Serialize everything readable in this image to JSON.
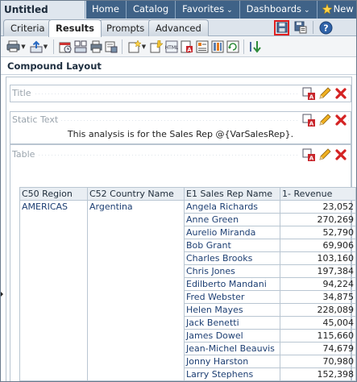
{
  "window": {
    "title": "Untitled"
  },
  "nav": {
    "links": [
      {
        "label": "Home",
        "caret": ""
      },
      {
        "label": "Catalog",
        "caret": ""
      },
      {
        "label": "Favorites",
        "caret": "⌄"
      },
      {
        "label": "Dashboards",
        "caret": "⌄"
      }
    ],
    "new_label": "New",
    "new_caret": "⌄"
  },
  "tabs": [
    {
      "label": "Criteria",
      "active": false
    },
    {
      "label": "Results",
      "active": true
    },
    {
      "label": "Prompts",
      "active": false
    },
    {
      "label": "Advanced",
      "active": false
    }
  ],
  "tab_icons": [
    "save-icon",
    "save-as-icon",
    "help-icon"
  ],
  "toolbar_icons": [
    "print-icon",
    "export-icon",
    "schedule-icon",
    "view-layout-icon",
    "print-preview-icon",
    "new-view-icon",
    "edit-view-icon",
    "html-icon",
    "pdf-icon",
    "properties-icon",
    "column-properties-icon",
    "refresh-icon",
    "sort-icon"
  ],
  "compound_layout": {
    "title": "Compound Layout",
    "views": {
      "title": {
        "label": "Title"
      },
      "static_text": {
        "label": "Static Text",
        "body": "This analysis is for the Sales Rep @{VarSalesRep}."
      },
      "table": {
        "label": "Table"
      }
    }
  },
  "table": {
    "columns": [
      "C50 Region",
      "C52 Country Name",
      "E1 Sales Rep Name",
      "1- Revenue"
    ],
    "region": "AMERICAS",
    "country": "Argentina",
    "rows": [
      {
        "rep": "Angela Richards",
        "revenue": "23,052"
      },
      {
        "rep": "Anne Green",
        "revenue": "270,269"
      },
      {
        "rep": "Aurelio Miranda",
        "revenue": "52,790"
      },
      {
        "rep": "Bob Grant",
        "revenue": "69,906"
      },
      {
        "rep": "Charles Brooks",
        "revenue": "103,160"
      },
      {
        "rep": "Chris Jones",
        "revenue": "197,384"
      },
      {
        "rep": "Edilberto Mandani",
        "revenue": "94,224"
      },
      {
        "rep": "Fred Webster",
        "revenue": "34,875"
      },
      {
        "rep": "Helen Mayes",
        "revenue": "228,089"
      },
      {
        "rep": "Jack Benetti",
        "revenue": "45,004"
      },
      {
        "rep": "James Dowel",
        "revenue": "115,660"
      },
      {
        "rep": "Jean-Michel Beauvis",
        "revenue": "74,679"
      },
      {
        "rep": "Jonny Harston",
        "revenue": "70,980"
      },
      {
        "rep": "Larry Stephens",
        "revenue": "152,398"
      }
    ]
  },
  "colors": {
    "nav_bg": "#3f6287",
    "link": "#1d3f73",
    "delete_red": "#d42222",
    "highlight_border": "#e02020"
  }
}
